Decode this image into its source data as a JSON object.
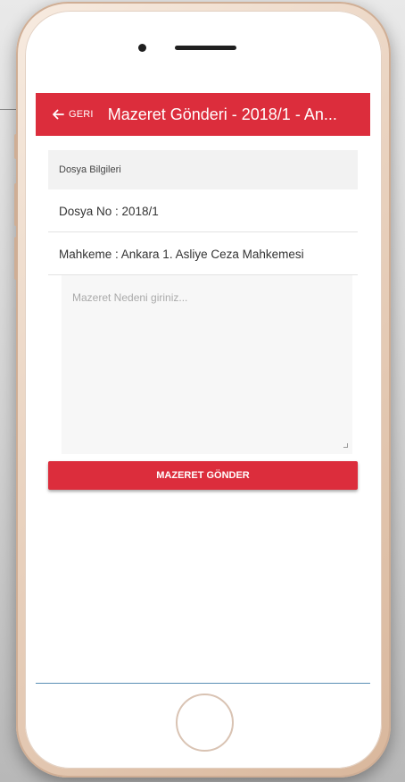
{
  "header": {
    "back_label": "GERI",
    "title": "Mazeret Gönderi - 2018/1 - An..."
  },
  "section": {
    "title": "Dosya Bilgileri"
  },
  "info": {
    "file_no": "Dosya No : 2018/1",
    "court": "Mahkeme : Ankara 1. Asliye Ceza Mahkemesi"
  },
  "reason": {
    "placeholder": "Mazeret Nedeni giriniz...",
    "value": ""
  },
  "submit": {
    "label": "MAZERET GÖNDER"
  },
  "colors": {
    "accent": "#dc2d3c",
    "section_bg": "#f2f2f2",
    "phone_frame": "#e9d2bf"
  },
  "icons": {
    "back": "arrow-left-icon",
    "camera": "camera-icon",
    "speaker": "speaker-icon",
    "home": "home-button-icon"
  }
}
